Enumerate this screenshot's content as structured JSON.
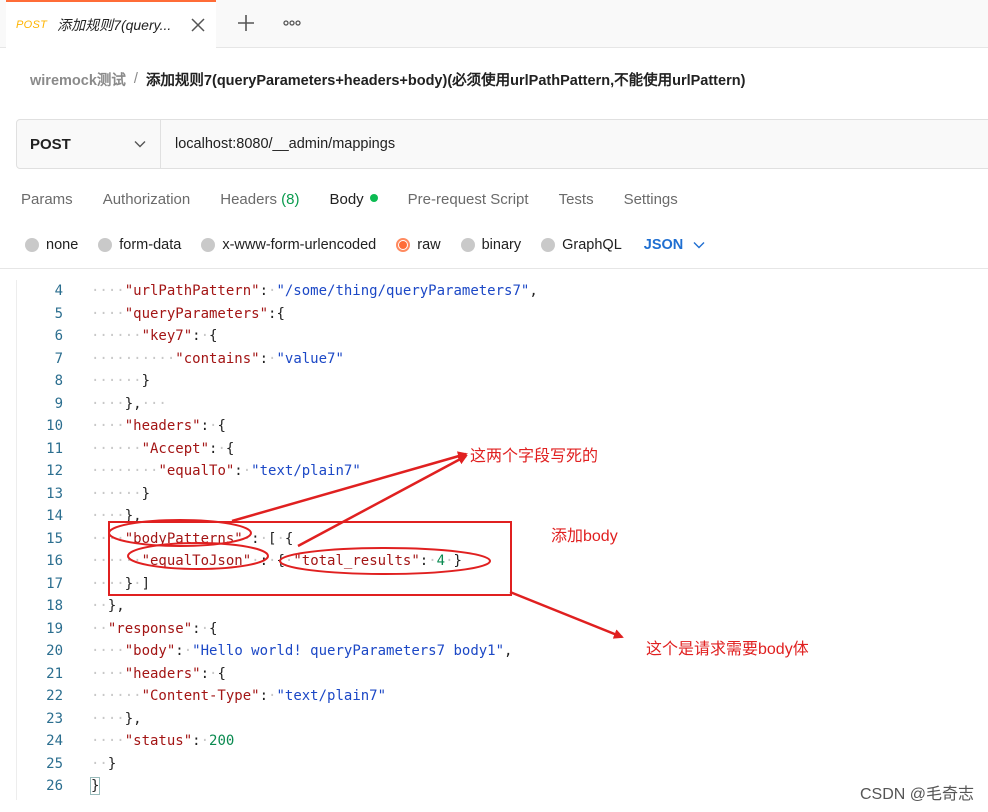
{
  "tab": {
    "method": "POST",
    "title": "添加规则7(query..."
  },
  "breadcrumb": {
    "parent": "wiremock测试",
    "separator": "/",
    "current": "添加规则7(queryParameters+headers+body)(必须使用urlPathPattern,不能使用urlPattern)"
  },
  "request": {
    "method": "POST",
    "url": "localhost:8080/__admin/mappings"
  },
  "request_tabs": [
    {
      "label": "Params"
    },
    {
      "label": "Authorization"
    },
    {
      "label": "Headers",
      "count": "(8)"
    },
    {
      "label": "Body"
    },
    {
      "label": "Pre-request Script"
    },
    {
      "label": "Tests"
    },
    {
      "label": "Settings"
    }
  ],
  "body_types": {
    "options": [
      "none",
      "form-data",
      "x-www-form-urlencoded",
      "raw",
      "binary",
      "GraphQL"
    ],
    "selected": "raw",
    "format": "JSON"
  },
  "code": {
    "line_numbers": [
      "4",
      "5",
      "6",
      "7",
      "8",
      "9",
      "10",
      "11",
      "12",
      "13",
      "14",
      "15",
      "16",
      "17",
      "18",
      "19",
      "20",
      "21",
      "22",
      "23",
      "24",
      "25",
      "26"
    ],
    "l4": {
      "key": "\"urlPathPattern\"",
      "value": "\"/some/thing/queryParameters7\""
    },
    "l5": {
      "key": "\"queryParameters\""
    },
    "l6": {
      "key": "\"key7\""
    },
    "l7": {
      "key": "\"contains\"",
      "value": "\"value7\""
    },
    "l10": {
      "key": "\"headers\""
    },
    "l11": {
      "key": "\"Accept\""
    },
    "l12": {
      "key": "\"equalTo\"",
      "value": "\"text/plain7\""
    },
    "l15": {
      "key": "\"bodyPatterns\""
    },
    "l16": {
      "key": "\"equalToJson\"",
      "inner_key": "\"total_results\"",
      "inner_value": "4"
    },
    "l19": {
      "key": "\"response\""
    },
    "l20": {
      "key": "\"body\"",
      "value": "\"Hello world! queryParameters7 body1\""
    },
    "l21": {
      "key": "\"headers\""
    },
    "l22": {
      "key": "\"Content-Type\"",
      "value": "\"text/plain7\""
    },
    "l24": {
      "key": "\"status\"",
      "value": "200"
    }
  },
  "annotations": {
    "fixed_fields": "这两个字段写死的",
    "add_body": "添加body",
    "request_body": "这个是请求需要body体",
    "color": "#e02020"
  },
  "watermark": "CSDN @毛奇志"
}
